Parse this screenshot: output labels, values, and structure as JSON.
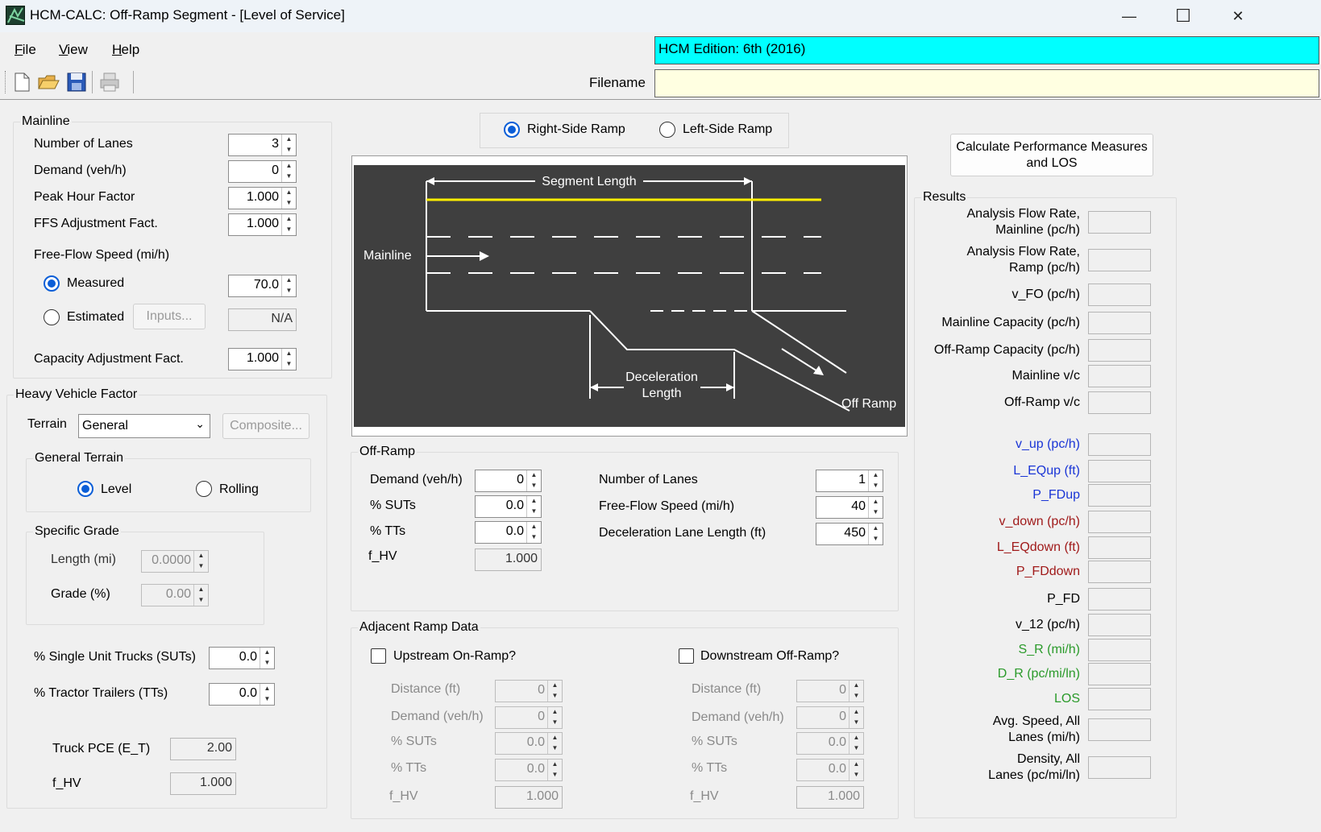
{
  "window": {
    "title": "HCM-CALC: Off-Ramp Segment - [Level of Service]",
    "minimize": "—",
    "maximize": "☐",
    "close": "✕"
  },
  "menu": [
    {
      "label": "File",
      "key": "F"
    },
    {
      "label": "View",
      "key": "V"
    },
    {
      "label": "Help",
      "key": "H"
    }
  ],
  "edition": "HCM Edition: 6th (2016)",
  "filename_label": "Filename",
  "filename_value": "",
  "toolbar_icons": [
    "new-file-icon",
    "open-folder-icon",
    "save-icon",
    "print-icon"
  ],
  "mainline": {
    "legend": "Mainline",
    "lanes_label": "Number of Lanes",
    "lanes": "3",
    "demand_label": "Demand (veh/h)",
    "demand": "0",
    "phf_label": "Peak Hour Factor",
    "phf": "1.000",
    "ffs_adj_label": "FFS Adjustment Fact.",
    "ffs_adj": "1.000",
    "ffs_label": "Free-Flow Speed (mi/h)",
    "measured_label": "Measured",
    "measured_value": "70.0",
    "estimated_label": "Estimated",
    "inputs_button": "Inputs...",
    "estimated_value": "N/A",
    "cap_adj_label": "Capacity Adjustment Fact.",
    "cap_adj": "1.000"
  },
  "hv": {
    "legend": "Heavy Vehicle Factor",
    "terrain_label": "Terrain",
    "terrain": "General",
    "composite_button": "Composite...",
    "general_legend": "General Terrain",
    "level": "Level",
    "rolling": "Rolling",
    "grade_legend": "Specific Grade",
    "length_label": "Length (mi)",
    "length": "0.0000",
    "grade_label": "Grade (%)",
    "grade": "0.00",
    "suts_label": "% Single Unit Trucks (SUTs)",
    "suts": "0.0",
    "tts_label": "% Tractor Trailers (TTs)",
    "tts": "0.0",
    "pce_label": "Truck PCE (E_T)",
    "pce": "2.00",
    "fhv_label": "f_HV",
    "fhv": "1.000"
  },
  "ramp_side": {
    "right": "Right-Side Ramp",
    "left": "Left-Side Ramp",
    "selected": "right"
  },
  "diagram": {
    "segment_length": "Segment Length",
    "mainline": "Mainline",
    "decel1": "Deceleration",
    "decel2": "Length",
    "off_ramp": "Off Ramp"
  },
  "offramp": {
    "legend": "Off-Ramp",
    "demand_label": "Demand (veh/h)",
    "demand": "0",
    "suts_label": "% SUTs",
    "suts": "0.0",
    "tts_label": "% TTs",
    "tts": "0.0",
    "fhv_label": "f_HV",
    "fhv": "1.000",
    "lanes_label": "Number of Lanes",
    "lanes": "1",
    "ffs_label": "Free-Flow Speed (mi/h)",
    "ffs": "40",
    "decel_label": "Deceleration Lane Length (ft)",
    "decel": "450"
  },
  "adjacent": {
    "legend": "Adjacent Ramp Data",
    "up_label": "Upstream On-Ramp?",
    "down_label": "Downstream Off-Ramp?",
    "distance_label": "Distance (ft)",
    "demand_label": "Demand (veh/h)",
    "suts_label": "% SUTs",
    "tts_label": "% TTs",
    "fhv_label": "f_HV",
    "up": {
      "distance": "0",
      "demand": "0",
      "suts": "0.0",
      "tts": "0.0",
      "fhv": "1.000"
    },
    "down": {
      "distance": "0",
      "demand": "0",
      "suts": "0.0",
      "tts": "0.0",
      "fhv": "1.000"
    }
  },
  "calc_button": {
    "line1": "Calculate Performance Measures",
    "line2": "and LOS"
  },
  "results": {
    "legend": "Results",
    "items": [
      {
        "l1": "Analysis Flow Rate,",
        "l2": "Mainline (pc/h)"
      },
      {
        "l1": "Analysis Flow Rate,",
        "l2": "Ramp (pc/h)"
      },
      {
        "l1": "v_FO (pc/h)",
        "l2": ""
      },
      {
        "l1": "Mainline Capacity (pc/h)",
        "l2": ""
      },
      {
        "l1": "Off-Ramp Capacity (pc/h)",
        "l2": ""
      },
      {
        "l1": "Mainline v/c",
        "l2": ""
      },
      {
        "l1": "Off-Ramp v/c",
        "l2": ""
      },
      {
        "l1": "v_up (pc/h)",
        "l2": ""
      },
      {
        "l1": "L_EQup (ft)",
        "l2": ""
      },
      {
        "l1": "P_FDup",
        "l2": ""
      },
      {
        "l1": "v_down (pc/h)",
        "l2": ""
      },
      {
        "l1": "L_EQdown (ft)",
        "l2": ""
      },
      {
        "l1": "P_FDdown",
        "l2": ""
      },
      {
        "l1": "P_FD",
        "l2": ""
      },
      {
        "l1": "v_12 (pc/h)",
        "l2": ""
      },
      {
        "l1": "S_R (mi/h)",
        "l2": ""
      },
      {
        "l1": "D_R (pc/mi/ln)",
        "l2": ""
      },
      {
        "l1": "LOS",
        "l2": ""
      },
      {
        "l1": "Avg. Speed, All",
        "l2": "Lanes (mi/h)"
      },
      {
        "l1": "Density, All",
        "l2": "Lanes (pc/mi/ln)"
      }
    ],
    "colors": {
      "default": "#000000",
      "upstream": "#1a35d6",
      "downstream": "#a01a1a",
      "ramp": "#2a9a2a"
    }
  }
}
